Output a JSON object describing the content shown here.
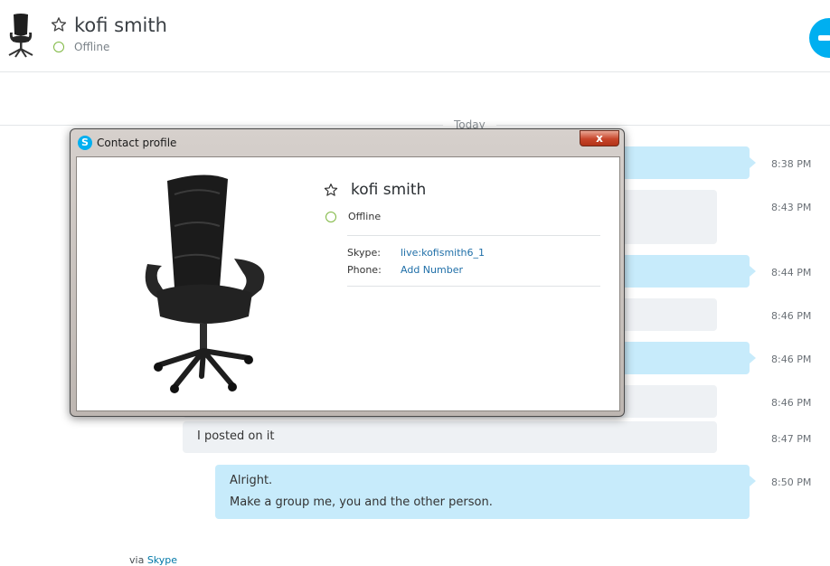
{
  "header": {
    "contact_name": "kofi smith",
    "status": "Offline",
    "icons": {
      "avatar": "office-chair-avatar",
      "favorite": "star-outline-icon",
      "call": "call-icon"
    }
  },
  "conversation": {
    "day_label": "Today",
    "messages": [
      {
        "direction": "out",
        "lines": [],
        "time": "8:38 PM"
      },
      {
        "direction": "in",
        "lines": [],
        "time": "8:43 PM"
      },
      {
        "direction": "out",
        "lines": [],
        "time": "8:44 PM"
      },
      {
        "direction": "in",
        "lines": [],
        "time": "8:46 PM"
      },
      {
        "direction": "out",
        "lines": [],
        "time": "8:46 PM"
      },
      {
        "direction": "in",
        "lines": [],
        "time": "8:46 PM"
      },
      {
        "direction": "in",
        "lines": [
          "I posted on it"
        ],
        "time": "8:47 PM"
      },
      {
        "direction": "out",
        "lines": [
          "Alright.",
          "Make a group me, you and the other person."
        ],
        "time": "8:50 PM"
      }
    ],
    "via_prefix": "via",
    "via_link": "Skype"
  },
  "contact_profile_dialog": {
    "title": "Contact profile",
    "close_label": "x",
    "app_icon_letter": "S",
    "name": "kofi smith",
    "status": "Offline",
    "fields": [
      {
        "label": "Skype:",
        "value": "live:kofismith6_1"
      },
      {
        "label": "Phone:",
        "value": "Add Number"
      }
    ]
  },
  "colors": {
    "status_offline_ring": "#7fb842",
    "outgoing_bubble": "#c7ebfb",
    "incoming_bubble": "#eef1f4",
    "link": "#1f6fa8",
    "skype_blue": "#00aff0"
  }
}
